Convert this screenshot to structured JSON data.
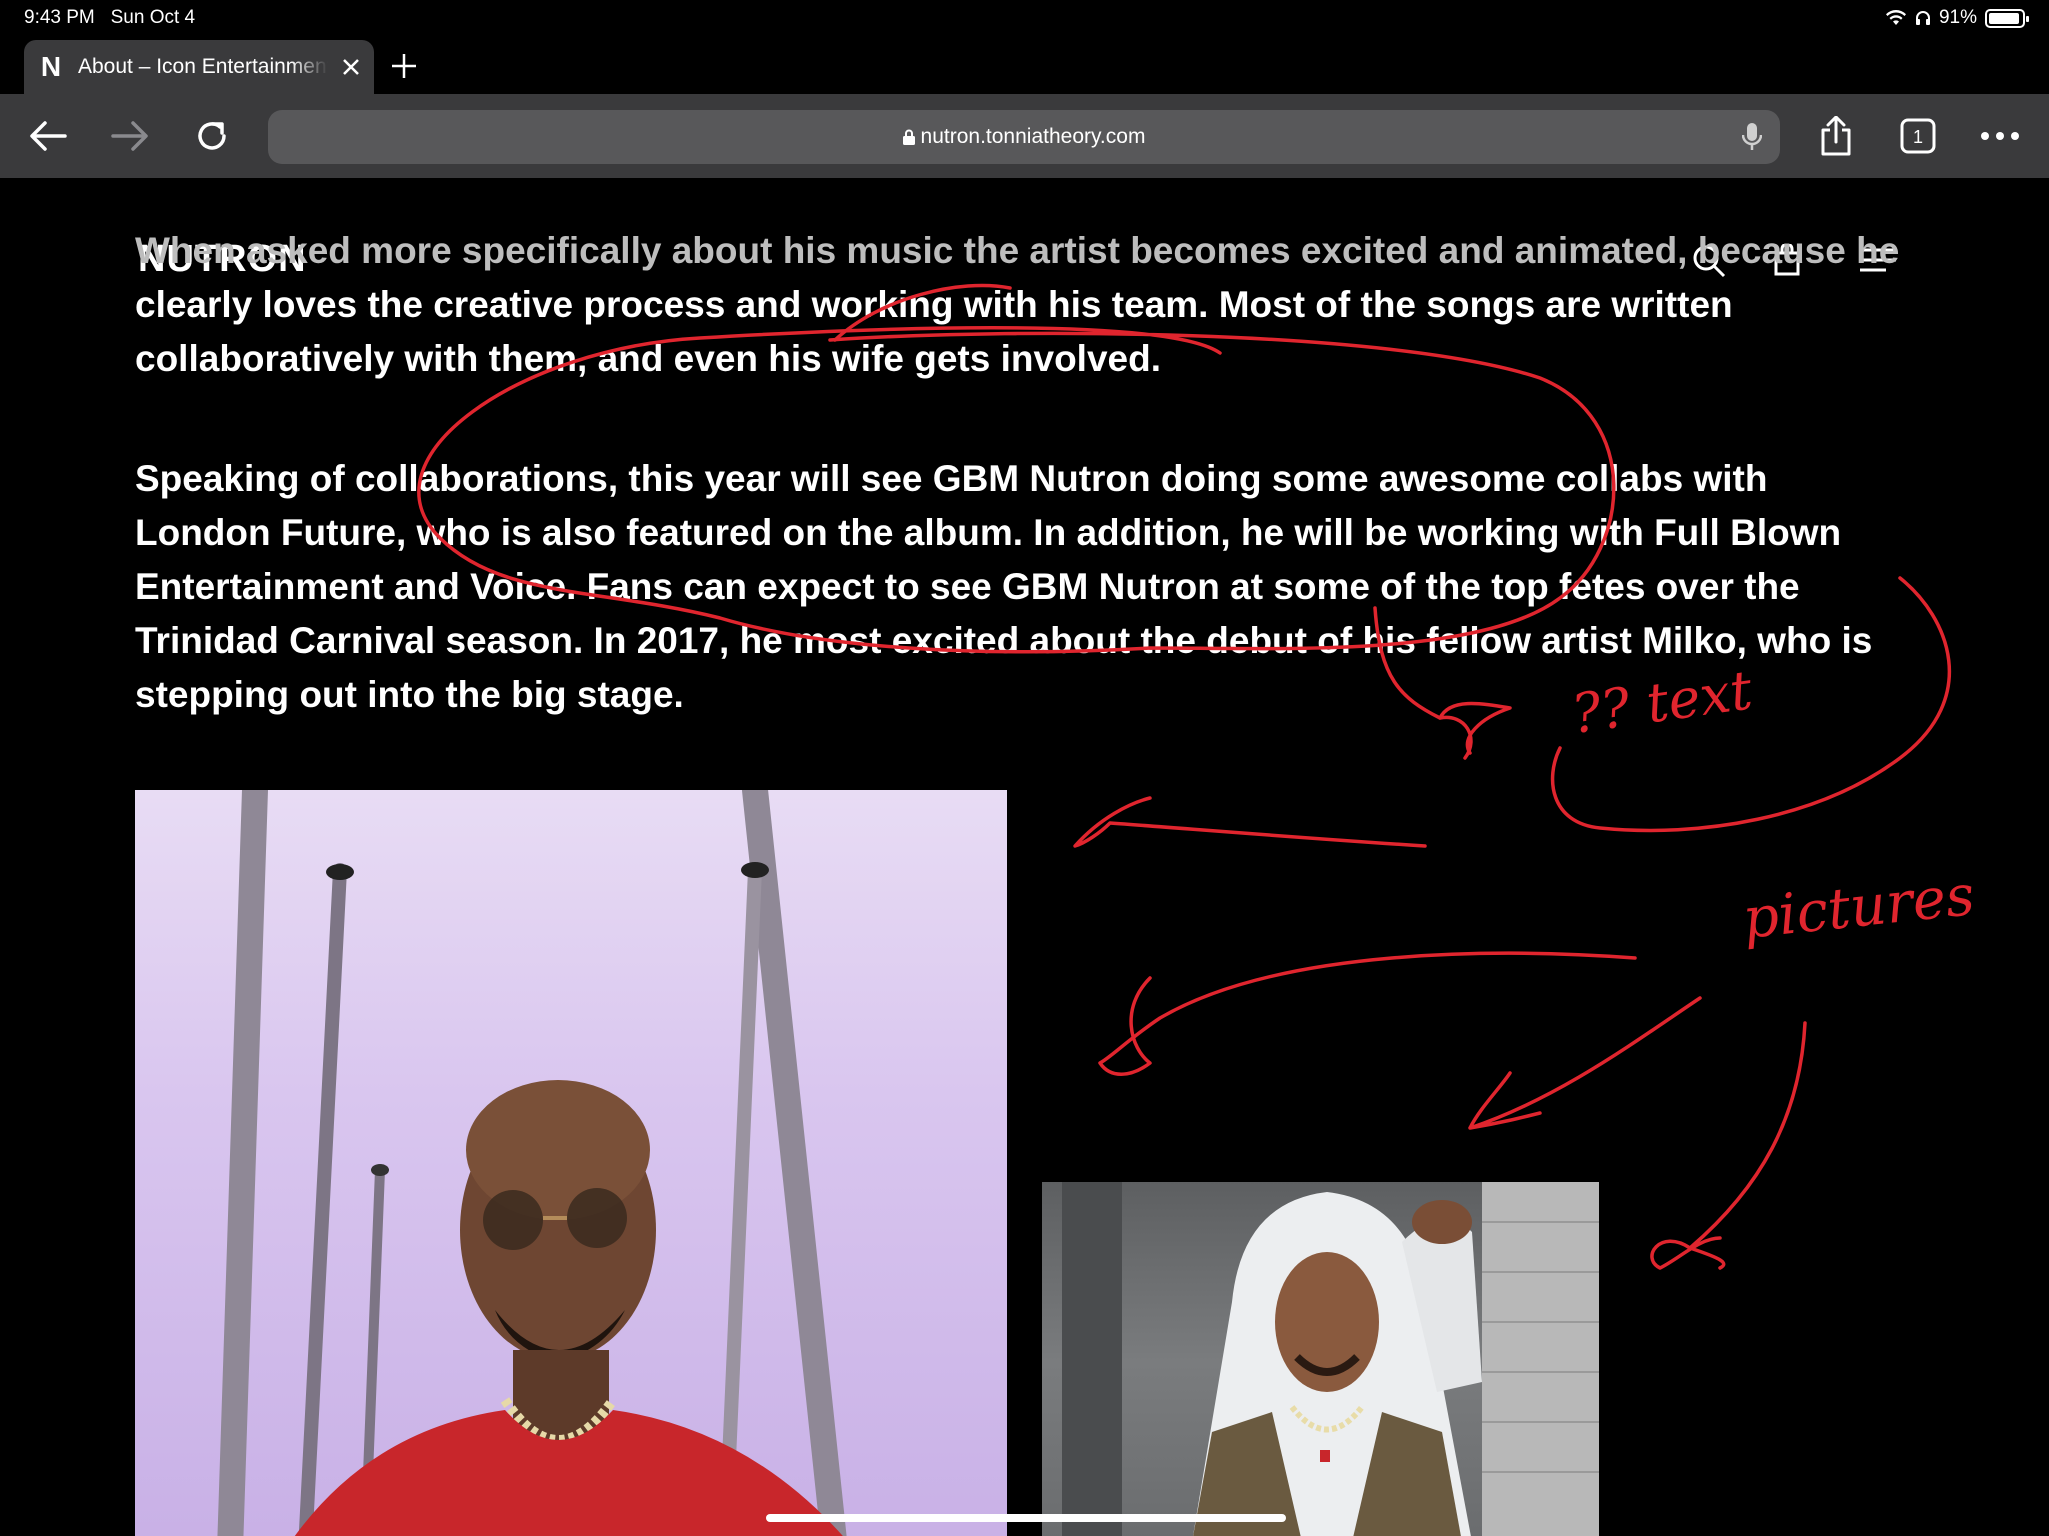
{
  "status": {
    "time": "9:43 PM",
    "date": "Sun Oct 4",
    "battery": "91%"
  },
  "browser": {
    "tab_title": "About – Icon Entertainment",
    "tab_favicon": "N",
    "url": "nutron.tonniatheory.com",
    "tab_count": "1"
  },
  "site": {
    "logo": "NUTRON"
  },
  "article": {
    "para1_faded": "When asked more specifically about his music the artist becomes excited and animated, because he",
    "para1_rest": "clearly loves the creative process and working with his team. Most of the songs are written collaboratively with them, and even his wife gets involved.",
    "para2": "Speaking of collaborations, this year will see GBM Nutron doing some awesome collabs with London Future, who is also featured on the album. In addition, he will be working with Full Blown Entertainment and Voice. Fans can expect to see GBM Nutron at some of the top fetes over the Trinidad Carnival season. In 2017, he most excited about the debut of his fellow artist Milko, who is stepping out into the big stage."
  },
  "annotations": {
    "note_text": "?? text",
    "note_pictures": "pictures",
    "stroke_color": "#e0252e"
  },
  "colors": {
    "toolbar": "#3a3a3c",
    "urlbar": "#58585a"
  }
}
